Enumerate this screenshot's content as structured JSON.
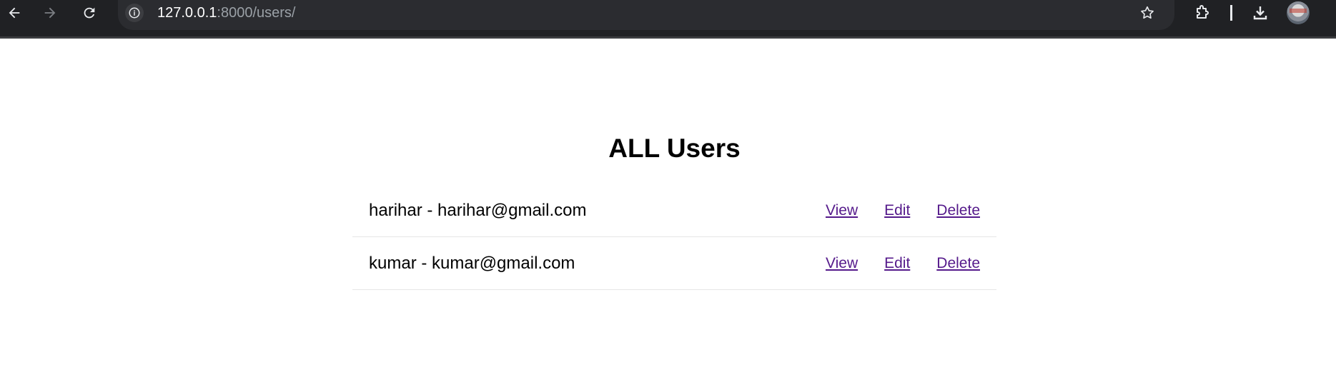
{
  "browser": {
    "url_host": "127.0.0.1",
    "url_path": ":8000/users/",
    "icons": [
      "back-icon",
      "forward-icon",
      "reload-icon",
      "site-info-icon",
      "bookmark-star-icon",
      "extensions-icon",
      "download-icon",
      "profile-avatar"
    ]
  },
  "page": {
    "title": "ALL Users",
    "users": [
      {
        "label": "harihar - harihar@gmail.com",
        "view": "View",
        "edit": "Edit",
        "delete": "Delete"
      },
      {
        "label": "kumar - kumar@gmail.com",
        "view": "View",
        "edit": "Edit",
        "delete": "Delete"
      }
    ]
  },
  "colors": {
    "toolbar_bg": "#202124",
    "omnibox_bg": "#2b2c30",
    "link_visited": "#551a8b"
  }
}
